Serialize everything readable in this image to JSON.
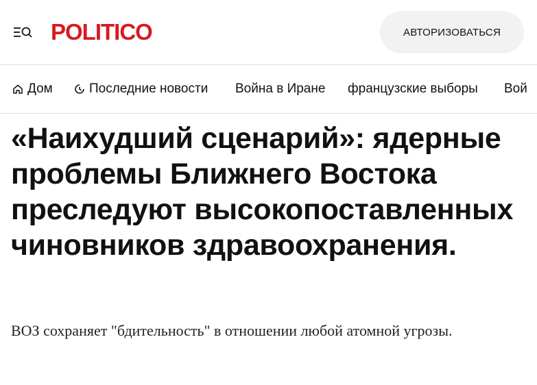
{
  "header": {
    "logo_text": "POLITICO",
    "login_label": "АВТОРИЗОВАТЬСЯ",
    "menu_icon": "menu-search-icon"
  },
  "nav": {
    "items": [
      {
        "label": "Дом",
        "icon": "home-icon"
      },
      {
        "label": "Последние новости",
        "icon": "clock-icon"
      },
      {
        "label": "Война в Иране"
      },
      {
        "label": "французские выборы"
      },
      {
        "label": "Вой"
      }
    ]
  },
  "article": {
    "headline": "«Наихудший сценарий»: ядерные проблемы Ближнего Востока преследуют высокопоставленных чиновников здравоохранения.",
    "dek": "ВОЗ сохраняет \"бдительность\" в отношении любой атомной угрозы."
  },
  "colors": {
    "brand": "#d71920",
    "button_bg": "#f2f2f2",
    "text": "#111111",
    "divider": "#dcdcdc"
  }
}
